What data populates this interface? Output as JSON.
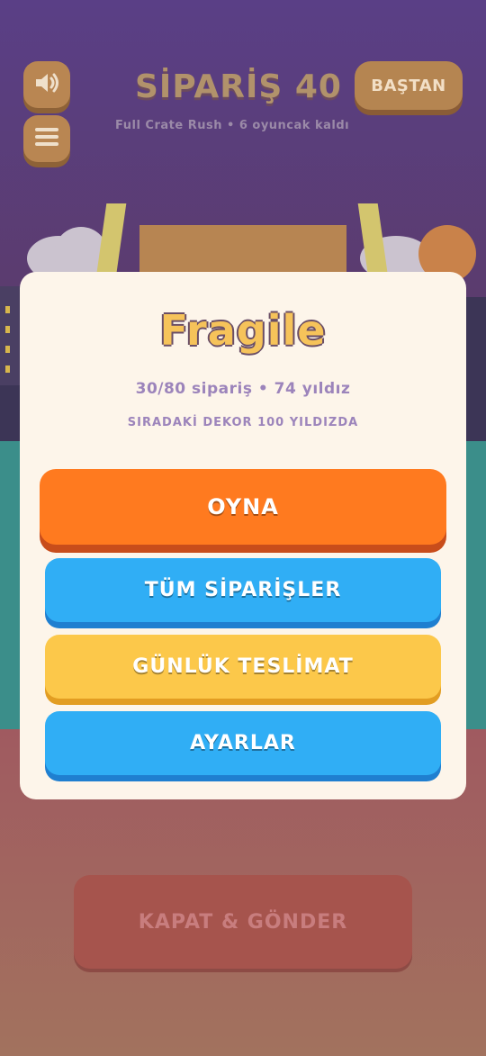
{
  "header": {
    "title": "SİPARİŞ 40",
    "subtitle": "Full Crate Rush • 6 oyuncak kaldı",
    "reset_label": "BAŞTAN",
    "sound_icon": "speaker-icon",
    "menu_icon": "hamburger-icon"
  },
  "game": {
    "submit_label": "KAPAT & GÖNDER"
  },
  "modal": {
    "title": "Fragile",
    "stats": "30/80 sipariş • 74 yıldız",
    "next_decor": "SIRADAKİ DEKOR 100 YILDIZDA",
    "buttons": {
      "play": "OYNA",
      "all_orders": "TÜM SİPARİŞLER",
      "daily_delivery": "GÜNLÜK TESLİMAT",
      "settings": "AYARLAR"
    }
  },
  "colors": {
    "play": "#ff7a1f",
    "blue": "#30aef5",
    "yellow": "#fcc84a",
    "panel": "#fdf5ea"
  }
}
